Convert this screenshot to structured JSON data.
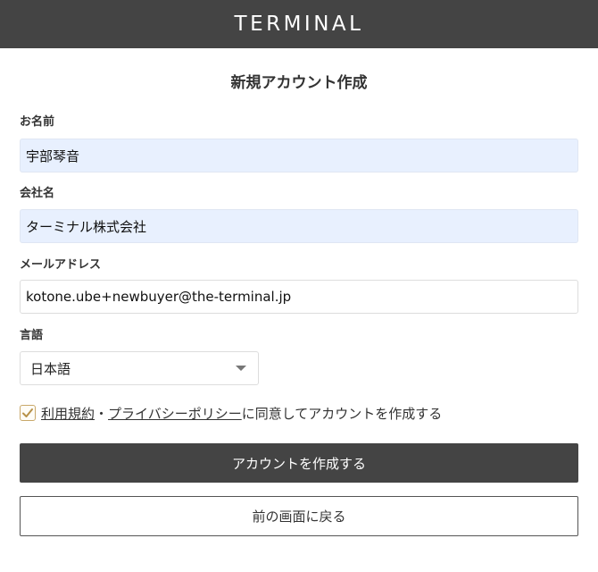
{
  "header": {
    "logo_text": "TERMINAL",
    "background": "#444444"
  },
  "page_title": "新規アカウント作成",
  "form": {
    "name": {
      "label": "お名前",
      "value": "宇部琴音"
    },
    "company": {
      "label": "会社名",
      "value": "ターミナル株式会社"
    },
    "email": {
      "label": "メールアドレス",
      "value": "kotone.ube+newbuyer@the-terminal.jp"
    },
    "language": {
      "label": "言語",
      "selected": "日本語"
    },
    "agreement": {
      "checked": true,
      "terms_link": "利用規約",
      "separator": "・",
      "privacy_link": "プライバシーポリシー",
      "suffix": "に同意してアカウントを作成する",
      "check_color": "#c9a86a"
    }
  },
  "buttons": {
    "create_label": "アカウントを作成する",
    "back_label": "前の画面に戻る"
  }
}
